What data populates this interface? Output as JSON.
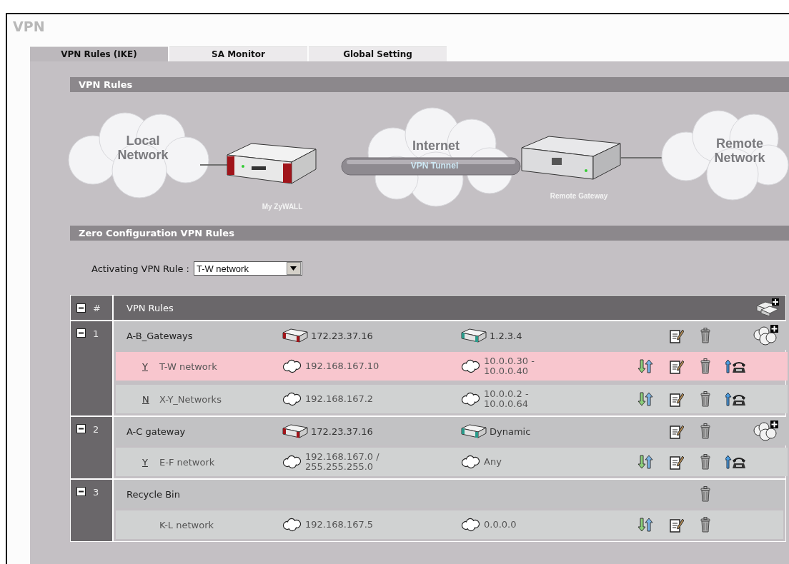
{
  "page_title": "VPN",
  "tabs": [
    {
      "label": "VPN Rules (IKE)",
      "selected": true
    },
    {
      "label": "SA Monitor",
      "selected": false
    },
    {
      "label": "Global Setting",
      "selected": false
    }
  ],
  "rules_section": {
    "title": "VPN Rules",
    "diagram": {
      "local_label": "Local Network",
      "local_device": "My ZyWALL",
      "internet_label": "Internet",
      "tunnel_label": "VPN Tunnel",
      "remote_device": "Remote Gateway",
      "remote_label": "Remote Network"
    }
  },
  "zero_config": {
    "title": "Zero Configuration VPN Rules",
    "activating_label": "Activating VPN Rule :",
    "activating_value": "T-W network"
  },
  "table": {
    "columns": [
      "#",
      "VPN Rules"
    ],
    "expanded": true,
    "groups": [
      {
        "number": "1",
        "kind": "gateway",
        "expanded": true,
        "name": "A-B_Gateways",
        "local": "172.23.37.16",
        "remote": "1.2.3.4",
        "rules": [
          {
            "status": "Y",
            "name": "T-W network",
            "local": "192.168.167.10",
            "remote": "10.0.0.30 - 10.0.0.40",
            "selected": true
          },
          {
            "status": "N",
            "name": "X-Y_Networks",
            "local": "192.168.167.2",
            "remote": "10.0.0.2 - 10.0.0.64",
            "selected": false
          }
        ]
      },
      {
        "number": "2",
        "kind": "gateway",
        "expanded": true,
        "name": "A-C gateway",
        "local": "172.23.37.16",
        "remote": "Dynamic",
        "rules": [
          {
            "status": "Y",
            "name": "E-F network",
            "local": "192.168.167.0 / 255.255.255.0",
            "remote": "Any",
            "selected": false
          }
        ]
      },
      {
        "number": "3",
        "kind": "recycle",
        "expanded": true,
        "name": "Recycle Bin",
        "rules": [
          {
            "name": "K-L network",
            "local": "192.168.167.5",
            "remote": "0.0.0.0",
            "selected": false
          }
        ]
      }
    ]
  }
}
